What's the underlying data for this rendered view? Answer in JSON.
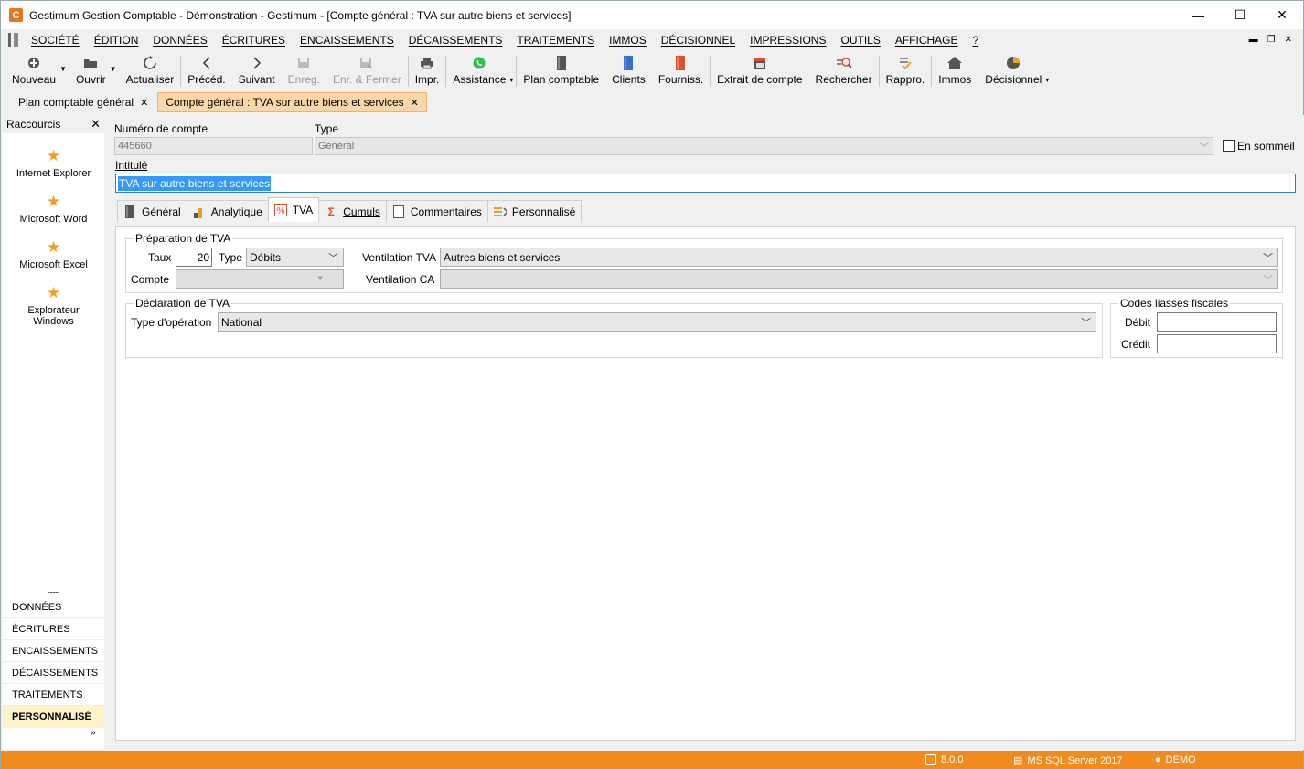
{
  "window": {
    "title": "Gestimum Gestion Comptable - Démonstration - Gestimum - [Compte général : TVA sur autre biens et services]",
    "logo": "C",
    "controls": [
      "—",
      "☐",
      "✕"
    ]
  },
  "menu": {
    "items": [
      "SOCIÉTÉ",
      "ÉDITION",
      "DONNÉES",
      "ÉCRITURES",
      "ENCAISSEMENTS",
      "DÉCAISSEMENTS",
      "TRAITEMENTS",
      "IMMOS",
      "DÉCISIONNEL",
      "IMPRESSIONS",
      "OUTILS",
      "AFFICHAGE",
      "?"
    ]
  },
  "toolbar": {
    "nouveau": "Nouveau",
    "ouvrir": "Ouvrir",
    "actualiser": "Actualiser",
    "preced": "Précéd.",
    "suivant": "Suivant",
    "enreg": "Enreg.",
    "enr_fermer": "Enr. & Fermer",
    "impr": "Impr.",
    "assistance": "Assistance",
    "plan_comptable": "Plan comptable",
    "clients": "Clients",
    "fourniss": "Fourniss.",
    "extrait": "Extrait de compte",
    "rechercher": "Rechercher",
    "rappro": "Rappro.",
    "immos": "Immos",
    "decisionnel": "Décisionnel"
  },
  "doc_tabs": [
    "Plan comptable général",
    "Compte général : TVA sur autre biens et services"
  ],
  "sidebar": {
    "title": "Raccourcis",
    "shortcuts": [
      "Internet Explorer",
      "Microsoft Word",
      "Microsoft Excel",
      "Explorateur Windows"
    ],
    "nav": [
      "DONNÉES",
      "ÉCRITURES",
      "ENCAISSEMENTS",
      "DÉCAISSEMENTS",
      "TRAITEMENTS",
      "PERSONNALISÉ"
    ],
    "dots": "........",
    "more": "»"
  },
  "form": {
    "numero_label": "Numéro de compte",
    "numero_value": "445660",
    "type_label": "Type",
    "type_value": "Général",
    "sommeil_label": "En sommeil",
    "intitule_label": "Intitulé",
    "intitule_value": "TVA sur autre biens et services"
  },
  "tabs": [
    "Général",
    "Analytique",
    "TVA",
    "Cumuls",
    "Commentaires",
    "Personnalisé"
  ],
  "tva": {
    "prep_title": "Préparation de TVA",
    "taux_label": "Taux",
    "taux_value": "20",
    "type_label": "Type",
    "type_value": "Débits",
    "compte_label": "Compte",
    "ventil_tva_label": "Ventilation TVA",
    "ventil_tva_value": "Autres biens et services",
    "ventil_ca_label": "Ventilation CA",
    "decl_title": "Déclaration de TVA",
    "type_op_label": "Type d'opération",
    "type_op_value": "National",
    "codes_title": "Codes liasses fiscales",
    "debit_label": "Débit",
    "credit_label": "Crédit"
  },
  "status": {
    "version": "8.0.0",
    "db": "MS SQL Server 2017",
    "user": "DEMO"
  }
}
